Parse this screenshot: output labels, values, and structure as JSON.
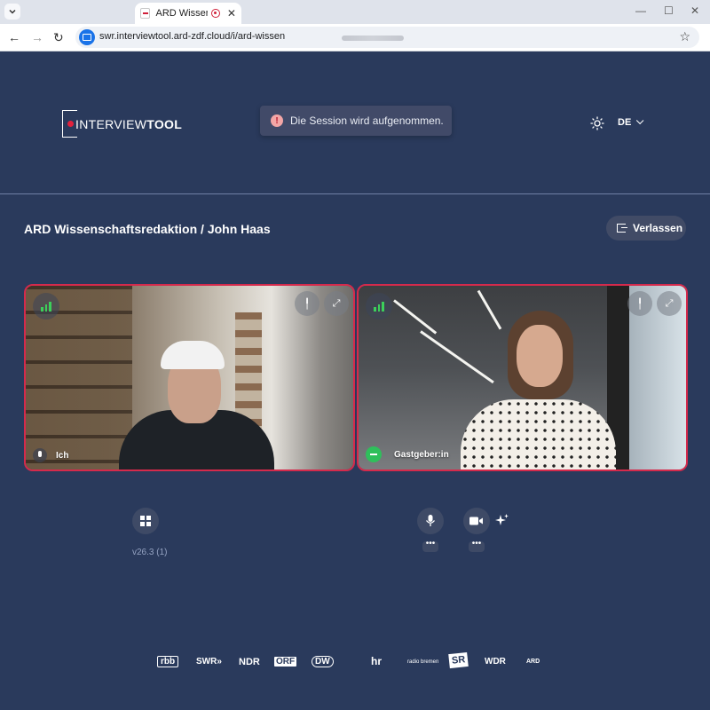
{
  "browser": {
    "tab_title": "ARD Wissenscha",
    "tab_close": "✕",
    "url": "swr.interviewtool.ard-zdf.cloud/i/ard-wissen"
  },
  "app": {
    "logo_prefix": "INTERVIEW",
    "logo_suffix": "TOOL",
    "toast_icon": "!",
    "toast_message": "Die Session wird aufgenommen.",
    "language": "DE",
    "room_title": "ARD Wissenschaftsredaktion / John Haas",
    "leave_label": "Verlassen",
    "version": "v26.3 (1)"
  },
  "tiles": [
    {
      "name": "Ich",
      "signal": "green",
      "border_color": "#d52a4c"
    },
    {
      "name": "Gastgeber:in",
      "signal": "green",
      "border_color": "#d52a4c"
    }
  ],
  "controls": {
    "more_label": "•••"
  },
  "broadcasters": [
    "rbb",
    "SWR»",
    "NDR",
    "ORF",
    "DW",
    "hr",
    "radio bremen",
    "SR",
    "WDR",
    "ARD"
  ],
  "colors": {
    "background": "#2a3a5c",
    "accent_red": "#d52a4c",
    "signal_green": "#3ccf5a",
    "host_green": "#2fbf5b"
  }
}
